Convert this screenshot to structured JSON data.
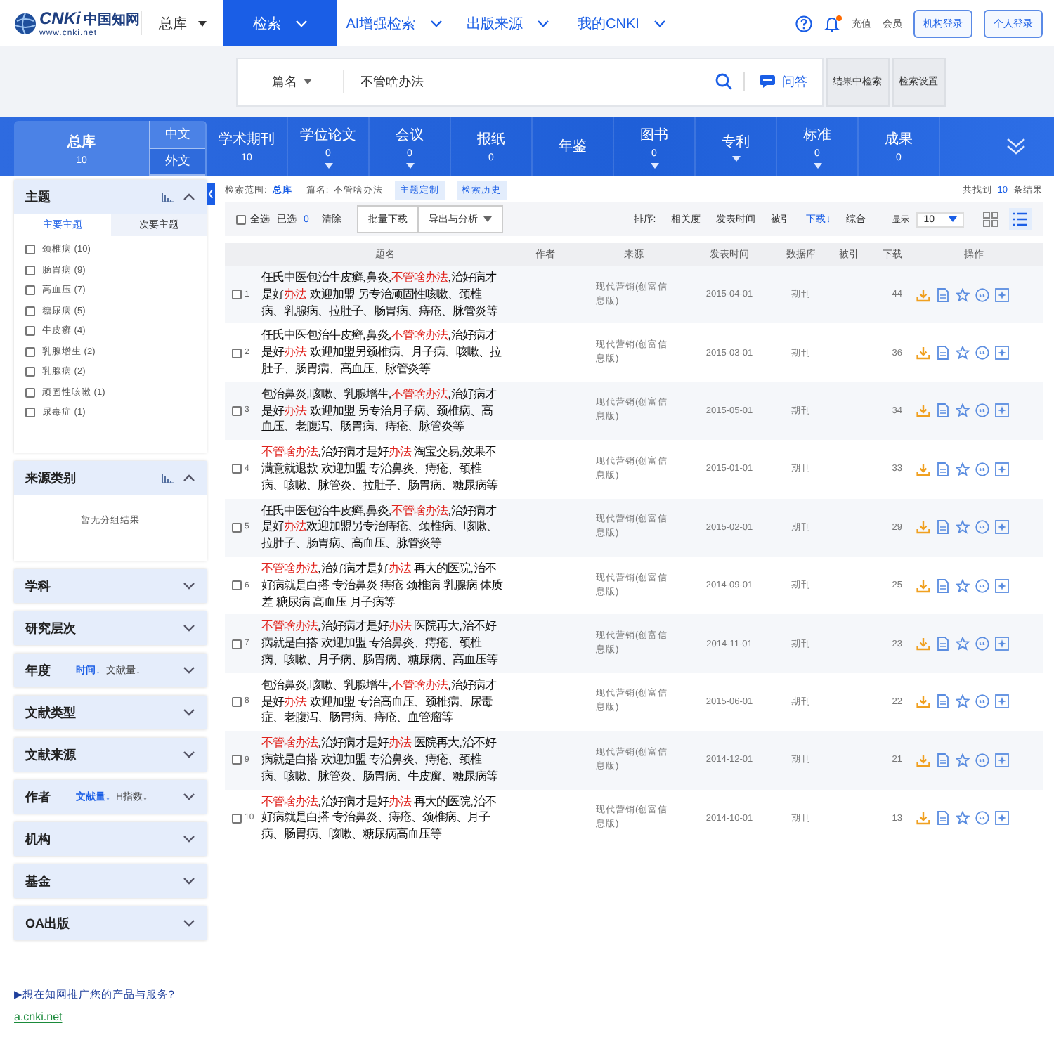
{
  "top_bar": {
    "logo": {
      "mark": "CNKi",
      "name": "中国知网",
      "url": "www.cnki.net"
    },
    "scope_menu": "总库",
    "nav": [
      {
        "label": "检索",
        "selected": true
      },
      {
        "label": "AI增强检索",
        "selected": false
      },
      {
        "label": "出版来源",
        "selected": false
      },
      {
        "label": "我的CNKI",
        "selected": false
      }
    ],
    "has_unread": true,
    "links": [
      "充值",
      "会员"
    ],
    "buttons": [
      "机构登录",
      "个人登录"
    ]
  },
  "search": {
    "field": "篇名",
    "value": "不管啥办法",
    "qa_label": "问答",
    "buttons": [
      "结果中检索",
      "检索设置"
    ]
  },
  "categories": [
    {
      "label": "总库",
      "count": "10",
      "selected": true,
      "has_menu": false,
      "languages": [
        "中文",
        "外文"
      ]
    },
    {
      "label": "学术期刊",
      "count": "10",
      "selected": false,
      "has_menu": false
    },
    {
      "label": "学位论文",
      "count": "0",
      "selected": false,
      "has_menu": true
    },
    {
      "label": "会议",
      "count": "0",
      "selected": false,
      "has_menu": true
    },
    {
      "label": "报纸",
      "count": "0",
      "selected": false,
      "has_menu": false
    },
    {
      "label": "年鉴",
      "selected": false,
      "has_menu": false
    },
    {
      "label": "图书",
      "count": "0",
      "selected": false,
      "has_menu": true
    },
    {
      "label": "专利",
      "selected": false,
      "has_menu": true
    },
    {
      "label": "标准",
      "count": "0",
      "selected": false,
      "has_menu": true
    },
    {
      "label": "成果",
      "count": "0",
      "selected": false,
      "has_menu": false
    }
  ],
  "sidebar": {
    "sections": [
      {
        "title": "主题",
        "expanded": true,
        "has_chart": true,
        "tabs": [
          {
            "label": "主要主题",
            "selected": true
          },
          {
            "label": "次要主题",
            "selected": false
          }
        ],
        "items": [
          {
            "label": "颈椎病 (10)",
            "checked": false
          },
          {
            "label": "肠胃病 (9)",
            "checked": false
          },
          {
            "label": "高血压 (7)",
            "checked": false
          },
          {
            "label": "糖尿病 (5)",
            "checked": false
          },
          {
            "label": "牛皮癣 (4)",
            "checked": false
          },
          {
            "label": "乳腺增生 (2)",
            "checked": false
          },
          {
            "label": "乳腺病 (2)",
            "checked": false
          },
          {
            "label": "顽固性咳嗽 (1)",
            "checked": false
          },
          {
            "label": "尿毒症 (1)",
            "checked": false
          }
        ]
      },
      {
        "title": "来源类别",
        "expanded": true,
        "has_chart": true,
        "empty_text": "暂无分组结果"
      },
      {
        "title": "学科",
        "expanded": false
      },
      {
        "title": "研究层次",
        "expanded": false
      },
      {
        "title": "年度",
        "expanded": false,
        "sorts": [
          {
            "label": "时间↓",
            "selected": true
          },
          {
            "label": "文献量↓",
            "selected": false
          }
        ]
      },
      {
        "title": "文献类型",
        "expanded": false
      },
      {
        "title": "文献来源",
        "expanded": false
      },
      {
        "title": "作者",
        "expanded": false,
        "sorts": [
          {
            "label": "文献量↓",
            "selected": true
          },
          {
            "label": "H指数↓",
            "selected": false
          }
        ]
      },
      {
        "title": "机构",
        "expanded": false
      },
      {
        "title": "基金",
        "expanded": false
      },
      {
        "title": "OA出版",
        "expanded": false
      }
    ],
    "promo": "▶想在知网推广您的产品与服务?",
    "site": "a.cnki.net"
  },
  "summary": {
    "scope_label": "检索范围:",
    "scope": "总库",
    "query_label": "篇名:",
    "query": "不管啥办法",
    "tags": [
      "主题定制",
      "检索历史"
    ],
    "found_prefix": "共找到",
    "found_count": "10",
    "found_suffix": "条结果"
  },
  "toolbar": {
    "select_all": {
      "label": "全选",
      "checked": false
    },
    "selected_label": "已选",
    "selected_count": "0",
    "clear": "清除",
    "buttons": [
      {
        "label": "批量下载",
        "has_menu": false
      },
      {
        "label": "导出与分析",
        "has_menu": true
      }
    ],
    "sort_label": "排序:",
    "sorts": [
      {
        "label": "相关度",
        "selected": false
      },
      {
        "label": "发表时间",
        "selected": false
      },
      {
        "label": "被引",
        "selected": false
      },
      {
        "label": "下载↓",
        "selected": true
      },
      {
        "label": "综合",
        "selected": false
      }
    ],
    "page_size_label": "显示",
    "page_size": "10",
    "views": [
      {
        "kind": "grid",
        "selected": false
      },
      {
        "kind": "list",
        "selected": true
      }
    ]
  },
  "table": {
    "columns": [
      "题名",
      "作者",
      "来源",
      "发表时间",
      "数据库",
      "被引",
      "下载",
      "操作"
    ],
    "rows": [
      {
        "number": "1",
        "checked": false,
        "title": [
          {
            "text": "任氏中医包治牛皮癣,鼻炎,",
            "highlight": false
          },
          {
            "text": "不管啥办法",
            "highlight": true
          },
          {
            "text": ",治好病才是好",
            "highlight": false
          },
          {
            "text": "办法",
            "highlight": true
          },
          {
            "text": " 欢迎加盟 另专治顽固性咳嗽、颈椎病、乳腺病、拉肚子、肠胃病、痔疮、脉管炎等",
            "highlight": false
          }
        ],
        "source": "现代营销(创富信息版)",
        "date": "2015-04-01",
        "database": "期刊",
        "downloads": "44"
      },
      {
        "number": "2",
        "checked": false,
        "title": [
          {
            "text": "任氏中医包治牛皮癣,鼻炎,",
            "highlight": false
          },
          {
            "text": "不管啥办法",
            "highlight": true
          },
          {
            "text": ",治好病才是好",
            "highlight": false
          },
          {
            "text": "办法",
            "highlight": true
          },
          {
            "text": " 欢迎加盟另颈椎病、月子病、咳嗽、拉肚子、肠胃病、高血压、脉管炎等",
            "highlight": false
          }
        ],
        "source": "现代营销(创富信息版)",
        "date": "2015-03-01",
        "database": "期刊",
        "downloads": "36"
      },
      {
        "number": "3",
        "checked": false,
        "title": [
          {
            "text": "包治鼻炎,咳嗽、乳腺增生,",
            "highlight": false
          },
          {
            "text": "不管啥办法",
            "highlight": true
          },
          {
            "text": ",治好病才是好",
            "highlight": false
          },
          {
            "text": "办法",
            "highlight": true
          },
          {
            "text": " 欢迎加盟 另专治月子病、颈椎病、高血压、老腹泻、肠胃病、痔疮、脉管炎等",
            "highlight": false
          }
        ],
        "source": "现代营销(创富信息版)",
        "date": "2015-05-01",
        "database": "期刊",
        "downloads": "34"
      },
      {
        "number": "4",
        "checked": false,
        "title": [
          {
            "text": "不管啥办法",
            "highlight": true
          },
          {
            "text": ",治好病才是好",
            "highlight": false
          },
          {
            "text": "办法",
            "highlight": true
          },
          {
            "text": " 淘宝交易,效果不满意就退款 欢迎加盟 专治鼻炎、痔疮、颈椎病、咳嗽、脉管炎、拉肚子、肠胃病、糖尿病等",
            "highlight": false
          }
        ],
        "source": "现代营销(创富信息版)",
        "date": "2015-01-01",
        "database": "期刊",
        "downloads": "33"
      },
      {
        "number": "5",
        "checked": false,
        "title": [
          {
            "text": "任氏中医包治牛皮癣,鼻炎,",
            "highlight": false
          },
          {
            "text": "不管啥办法",
            "highlight": true
          },
          {
            "text": ",治好病才是好",
            "highlight": false
          },
          {
            "text": "办法",
            "highlight": true
          },
          {
            "text": "欢迎加盟另专治痔疮、颈椎病、咳嗽、拉肚子、肠胃病、高血压、脉管炎等",
            "highlight": false
          }
        ],
        "source": "现代营销(创富信息版)",
        "date": "2015-02-01",
        "database": "期刊",
        "downloads": "29"
      },
      {
        "number": "6",
        "checked": false,
        "title": [
          {
            "text": "不管啥办法",
            "highlight": true
          },
          {
            "text": ",治好病才是好",
            "highlight": false
          },
          {
            "text": "办法",
            "highlight": true
          },
          {
            "text": " 再大的医院,治不好病就是白搭 专治鼻炎 痔疮 颈椎病 乳腺病 体质差 糖尿病 高血压 月子病等",
            "highlight": false
          }
        ],
        "source": "现代营销(创富信息版)",
        "date": "2014-09-01",
        "database": "期刊",
        "downloads": "25"
      },
      {
        "number": "7",
        "checked": false,
        "title": [
          {
            "text": "不管啥办法",
            "highlight": true
          },
          {
            "text": ",治好病才是好",
            "highlight": false
          },
          {
            "text": "办法",
            "highlight": true
          },
          {
            "text": " 医院再大,治不好病就是白搭 欢迎加盟 专治鼻炎、痔疮、颈椎病、咳嗽、月子病、肠胃病、糖尿病、高血压等",
            "highlight": false
          }
        ],
        "source": "现代营销(创富信息版)",
        "date": "2014-11-01",
        "database": "期刊",
        "downloads": "23"
      },
      {
        "number": "8",
        "checked": false,
        "title": [
          {
            "text": "包治鼻炎,咳嗽、乳腺增生,",
            "highlight": false
          },
          {
            "text": "不管啥办法",
            "highlight": true
          },
          {
            "text": ",治好病才是好",
            "highlight": false
          },
          {
            "text": "办法",
            "highlight": true
          },
          {
            "text": " 欢迎加盟 专治高血压、颈椎病、尿毒症、老腹泻、肠胃病、痔疮、血管瘤等",
            "highlight": false
          }
        ],
        "source": "现代营销(创富信息版)",
        "date": "2015-06-01",
        "database": "期刊",
        "downloads": "22"
      },
      {
        "number": "9",
        "checked": false,
        "title": [
          {
            "text": "不管啥办法",
            "highlight": true
          },
          {
            "text": ",治好病才是好",
            "highlight": false
          },
          {
            "text": "办法",
            "highlight": true
          },
          {
            "text": " 医院再大,治不好病就是白搭 欢迎加盟 专治鼻炎、痔疮、颈椎病、咳嗽、脉管炎、肠胃病、牛皮癣、糖尿病等",
            "highlight": false
          }
        ],
        "source": "现代营销(创富信息版)",
        "date": "2014-12-01",
        "database": "期刊",
        "downloads": "21"
      },
      {
        "number": "10",
        "checked": false,
        "title": [
          {
            "text": "不管啥办法",
            "highlight": true
          },
          {
            "text": ",治好病才是好",
            "highlight": false
          },
          {
            "text": "办法",
            "highlight": true
          },
          {
            "text": " 再大的医院,治不好病就是白搭 专治鼻炎、痔疮、颈椎病、月子病、肠胃病、咳嗽、糖尿病高血压等",
            "highlight": false
          }
        ],
        "source": "现代营销(创富信息版)",
        "date": "2014-10-01",
        "database": "期刊",
        "downloads": "13"
      }
    ]
  }
}
